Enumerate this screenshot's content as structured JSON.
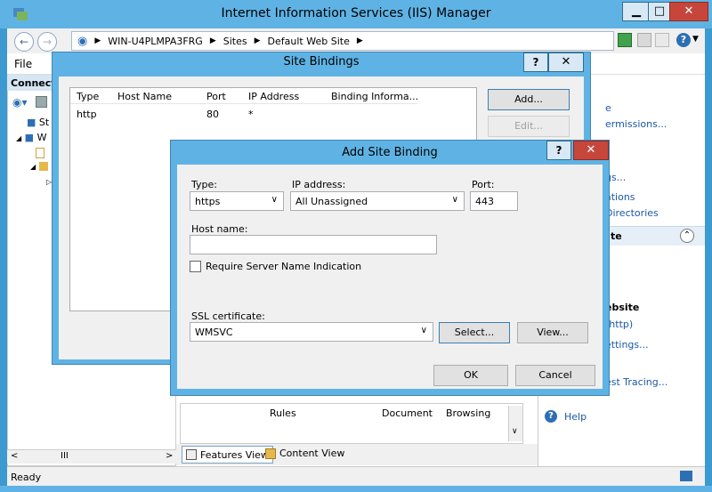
{
  "main_window": {
    "title": "Internet Information Services (IIS) Manager",
    "minimize": "▁",
    "maximize": "□",
    "close": "✕"
  },
  "address_bar": {
    "back": "←",
    "forward": "→",
    "crumbs": [
      "WIN-U4PLMPA3FRG",
      "Sites",
      "Default Web Site"
    ],
    "sep": "▶"
  },
  "toolbar_right": {
    "help": "?"
  },
  "menu": {
    "file": "File"
  },
  "connections": {
    "header": "Connect",
    "tree_items": [
      "St",
      "W"
    ]
  },
  "site_bindings": {
    "title": "Site Bindings",
    "help": "?",
    "close": "✕",
    "columns": [
      "Type",
      "Host Name",
      "Port",
      "IP Address",
      "Binding Informa..."
    ],
    "rows": [
      {
        "type": "http",
        "host": "",
        "port": "80",
        "ip": "*",
        "info": ""
      }
    ],
    "buttons": {
      "add": "Add...",
      "edit": "Edit..."
    }
  },
  "add_site_binding": {
    "title": "Add Site Binding",
    "help": "?",
    "close": "✕",
    "type_label": "Type:",
    "type_value": "https",
    "ip_label": "IP address:",
    "ip_value": "All Unassigned",
    "port_label": "Port:",
    "port_value": "443",
    "host_label": "Host name:",
    "host_value": "",
    "sni_label": "Require Server Name Indication",
    "sni_checked": false,
    "ssl_label": "SSL certificate:",
    "ssl_value": "WMSVC",
    "select_btn": "Select...",
    "view_btn": "View...",
    "ok_btn": "OK",
    "cancel_btn": "Cancel"
  },
  "actions_pane": {
    "items": [
      {
        "text": "e",
        "kind": "link"
      },
      {
        "text": "ermissions...",
        "kind": "link"
      },
      {
        "text": "gs...",
        "kind": "link"
      },
      {
        "text": "ations",
        "kind": "link"
      },
      {
        "text": "Directories",
        "kind": "link"
      }
    ],
    "section_te": "te",
    "website_head": "ebsite",
    "website_items": [
      "(http)",
      "ettings..."
    ],
    "tracing": "est Tracing...",
    "help": "Help"
  },
  "features": {
    "rules": "Rules",
    "document": "Document",
    "browsing": "Browsing"
  },
  "tabs": {
    "features_view": "Features View",
    "content_view": "Content View"
  },
  "status": {
    "text": "Ready"
  }
}
